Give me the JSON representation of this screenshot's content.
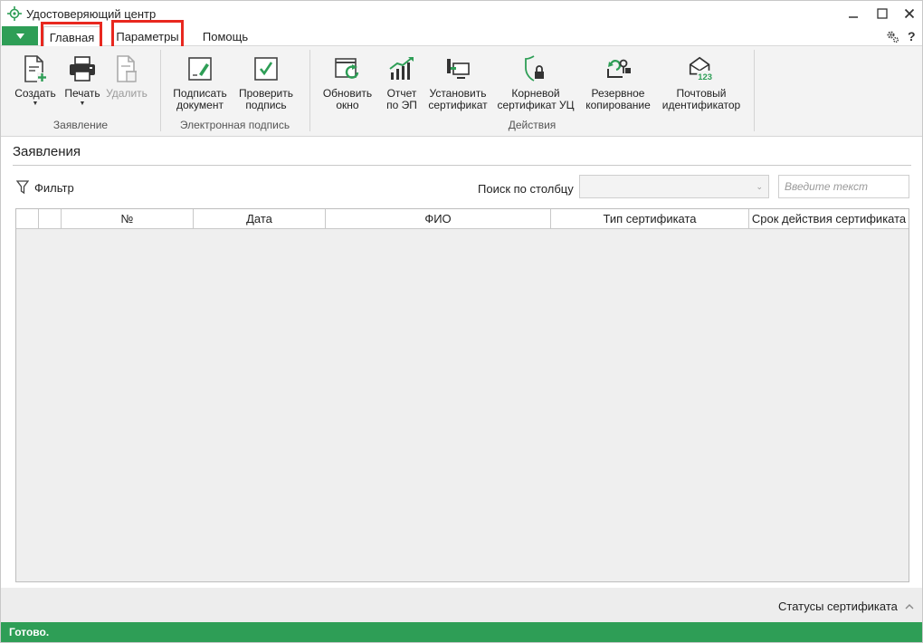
{
  "window": {
    "title": "Удостоверяющий центр",
    "accent_color": "#2e9e56"
  },
  "menu": {
    "tabs": [
      {
        "label": "Главная",
        "active": true,
        "highlighted": true
      },
      {
        "label": "Параметры",
        "active": false,
        "highlighted": true
      },
      {
        "label": "Помощь",
        "active": false,
        "highlighted": false
      }
    ],
    "highlight_color": "#e8281f",
    "help_label": "?"
  },
  "ribbon": {
    "groups": [
      {
        "label": "Заявление",
        "buttons": [
          {
            "label": "Создать",
            "icon": "create-document-icon",
            "dropdown": true,
            "enabled": true
          },
          {
            "label": "Печать",
            "icon": "printer-icon",
            "dropdown": true,
            "enabled": true
          },
          {
            "label": "Удалить",
            "icon": "delete-document-icon",
            "dropdown": false,
            "enabled": false
          }
        ]
      },
      {
        "label": "Электронная подпись",
        "buttons": [
          {
            "label": "Подписать документ",
            "icon": "sign-document-icon",
            "enabled": true
          },
          {
            "label": "Проверить подпись",
            "icon": "check-signature-icon",
            "enabled": true
          }
        ]
      },
      {
        "label": "Действия",
        "buttons": [
          {
            "label": "Обновить окно",
            "icon": "refresh-window-icon",
            "enabled": true
          },
          {
            "label": "Отчет по ЭП",
            "icon": "report-chart-icon",
            "enabled": true
          },
          {
            "label": "Установить сертификат",
            "icon": "install-certificate-icon",
            "enabled": true
          },
          {
            "label": "Корневой сертификат УЦ",
            "icon": "root-certificate-shield-icon",
            "enabled": true
          },
          {
            "label": "Резервное копирование",
            "icon": "backup-key-icon",
            "enabled": true
          },
          {
            "label": "Почтовый идентификатор",
            "icon": "mail-identifier-icon",
            "enabled": true
          }
        ]
      }
    ]
  },
  "content": {
    "section_title": "Заявления",
    "filter_label": "Фильтр",
    "search_by_column_label": "Поиск по столбцу",
    "search_column_value": "",
    "search_placeholder": "Введите текст"
  },
  "table": {
    "columns": [
      "",
      "",
      "№",
      "Дата",
      "ФИО",
      "Тип сертификата",
      "Срок действия сертификата"
    ],
    "rows": []
  },
  "footer": {
    "statuses_label": "Статусы сертификата",
    "status_text": "Готово."
  }
}
